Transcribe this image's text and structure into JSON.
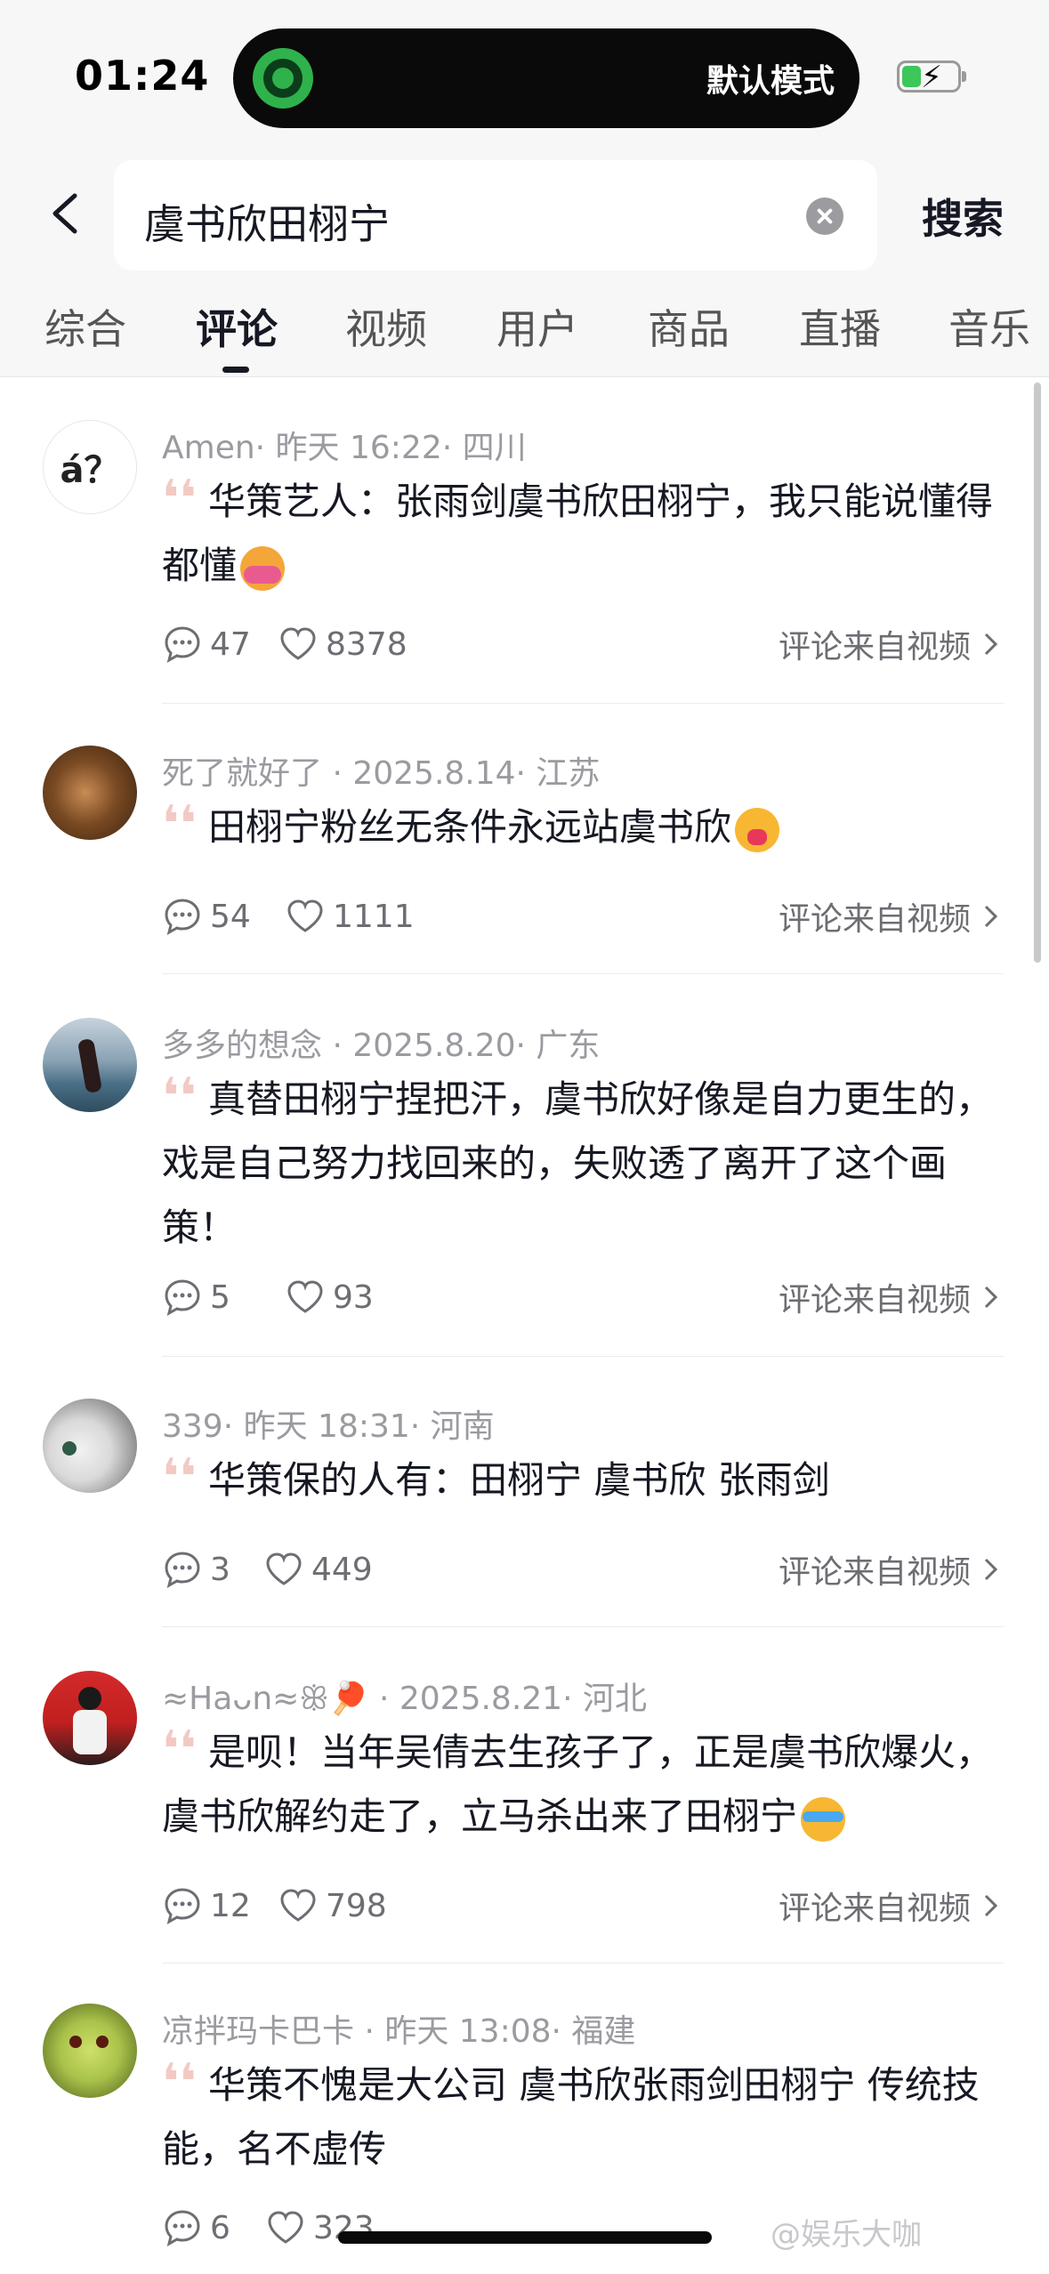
{
  "status_bar": {
    "time": "01:24",
    "island_text": "默认模式",
    "battery_level": 0.35,
    "battery_color": "#3cc75b"
  },
  "search": {
    "query": "虞书欣田栩宁",
    "submit_label": "搜索"
  },
  "tabs": [
    {
      "label": "综合"
    },
    {
      "label": "评论",
      "active": true
    },
    {
      "label": "视频"
    },
    {
      "label": "用户"
    },
    {
      "label": "商品"
    },
    {
      "label": "直播"
    },
    {
      "label": "音乐"
    }
  ],
  "comments": [
    {
      "avatar_text": "á？",
      "user": "Amen",
      "meta": "Amen· 昨天 16:22· 四川",
      "text": "华策艺人：张雨剑虞书欣田栩宁，我只能说懂得都懂",
      "emoji": "hug",
      "replies": "47",
      "likes": "8378",
      "source": "评论来自视频"
    },
    {
      "meta": "死了就好了 · 2025.8.14· 江苏",
      "text": "田栩宁粉丝无条件永远站虞书欣",
      "emoji": "love",
      "replies": "54",
      "likes": "1111",
      "source": "评论来自视频"
    },
    {
      "meta": "多多的想念 · 2025.8.20· 广东",
      "text": "真替田栩宁捏把汗，虞书欣好像是自力更生的，戏是自己努力找回来的，失败透了离开了这个画策！",
      "replies": "5",
      "likes": "93",
      "source": "评论来自视频"
    },
    {
      "meta": "339· 昨天 18:31· 河南",
      "text": "华策保的人有：田栩宁 虞书欣 张雨剑",
      "replies": "3",
      "likes": "449",
      "source": "评论来自视频"
    },
    {
      "meta": "≈Haᴗn≈ꕥ🏓 · 2025.8.21· 河北",
      "text": "是呗！当年吴倩去生孩子了，正是虞书欣爆火，虞书欣解约走了，立马杀出来了田栩宁",
      "emoji": "cry",
      "replies": "12",
      "likes": "798",
      "source": "评论来自视频"
    },
    {
      "meta": "凉拌玛卡巴卡 · 昨天 13:08· 福建",
      "text": "华策不愧是大公司 虞书欣张雨剑田栩宁 传统技能，名不虚传",
      "replies": "6",
      "likes": "323",
      "source": ""
    }
  ],
  "watermark": "@娱乐大咖"
}
